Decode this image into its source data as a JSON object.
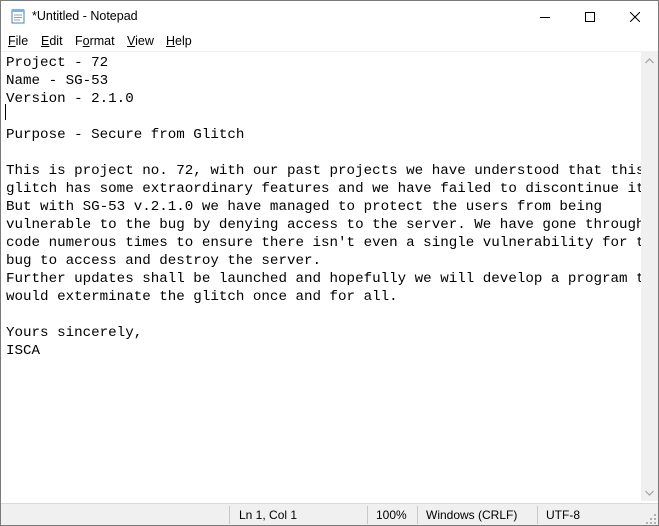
{
  "window": {
    "title": "*Untitled - Notepad",
    "icon": "notepad-icon"
  },
  "menu": {
    "file": {
      "accel": "F",
      "rest": "ile"
    },
    "edit": {
      "accel": "E",
      "rest": "dit"
    },
    "format": {
      "pre": "F",
      "accel": "o",
      "rest": "rmat"
    },
    "view": {
      "accel": "V",
      "rest": "iew"
    },
    "help": {
      "accel": "H",
      "rest": "elp"
    }
  },
  "document": {
    "content": "Project - 72\nName - SG-53\nVersion - 2.1.0\n\nPurpose - Secure from Glitch\n\nThis is project no. 72, with our past projects we have understood that this\nglitch has some extraordinary features and we have failed to discontinue it.\nBut with SG-53 v.2.1.0 we have managed to protect the users from being\nvulnerable to the bug by denying access to the server. We have gone through the\ncode numerous times to ensure there isn't even a single vulnerability for the\nbug to access and destroy the server.\nFurther updates shall be launched and hopefully we will develop a program that\nwould exterminate the glitch once and for all.\n\nYours sincerely,\nISCA"
  },
  "status": {
    "position": "Ln 1, Col 1",
    "zoom": "100%",
    "line_ending": "Windows (CRLF)",
    "encoding": "UTF-8"
  }
}
